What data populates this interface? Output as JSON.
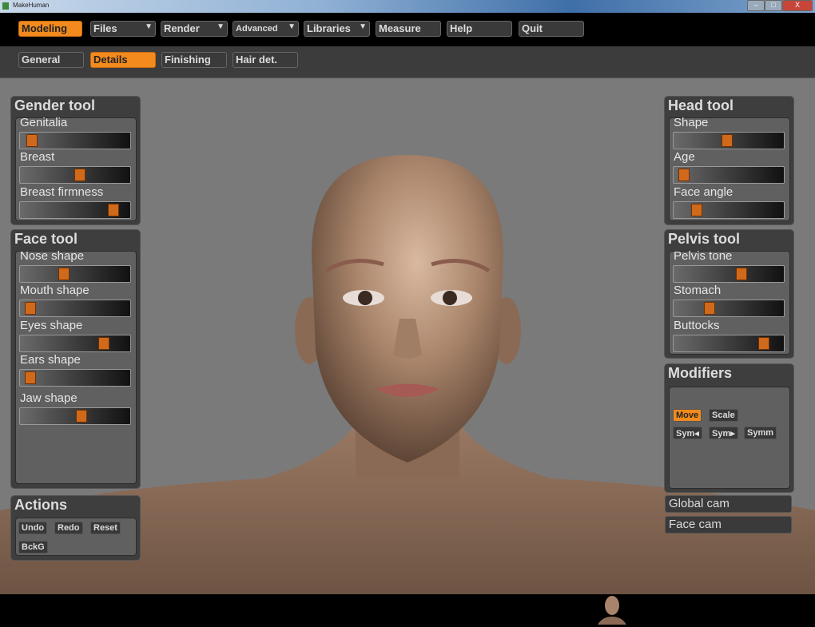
{
  "window": {
    "title": "MakeHuman",
    "minimize": "–",
    "maximize": "□",
    "close": "X"
  },
  "menu": [
    {
      "label": "Modeling",
      "active": true
    },
    {
      "label": "Files",
      "dropdown": true
    },
    {
      "label": "Render",
      "dropdown": true
    },
    {
      "label": "Advanced",
      "dropdown": true
    },
    {
      "label": "Libraries",
      "dropdown": true
    },
    {
      "label": "Measure"
    },
    {
      "label": "Help"
    },
    {
      "label": "Quit"
    }
  ],
  "arrow": "▼",
  "subtabs": [
    {
      "label": "General"
    },
    {
      "label": "Details",
      "active": true
    },
    {
      "label": "Finishing"
    },
    {
      "label": "Hair det."
    }
  ],
  "gender_tool": {
    "title": "Gender tool",
    "sliders": [
      {
        "label": "Genitalia",
        "value": 0.05
      },
      {
        "label": "Breast",
        "value": 0.55
      },
      {
        "label": "Breast firmness",
        "value": 0.9
      }
    ]
  },
  "face_tool": {
    "title": "Face tool",
    "sliders": [
      {
        "label": "Nose shape",
        "value": 0.38
      },
      {
        "label": "Mouth shape",
        "value": 0.03
      },
      {
        "label": "Eyes shape",
        "value": 0.8
      },
      {
        "label": "Ears shape",
        "value": 0.03
      },
      {
        "label": "Jaw shape",
        "value": 0.57
      }
    ]
  },
  "actions": {
    "title": "Actions",
    "buttons": [
      "Undo",
      "Redo",
      "Reset",
      "BckG"
    ]
  },
  "head_tool": {
    "title": "Head tool",
    "sliders": [
      {
        "label": "Shape",
        "value": 0.48
      },
      {
        "label": "Age",
        "value": 0.03
      },
      {
        "label": "Face angle",
        "value": 0.17
      }
    ]
  },
  "pelvis_tool": {
    "title": "Pelvis tool",
    "sliders": [
      {
        "label": "Pelvis tone",
        "value": 0.63
      },
      {
        "label": "Stomach",
        "value": 0.3
      },
      {
        "label": "Buttocks",
        "value": 0.87
      }
    ]
  },
  "modifiers": {
    "title": "Modifiers",
    "buttons": [
      {
        "label": "Move",
        "active": true
      },
      {
        "label": "Scale"
      },
      {
        "label": "Sym◂"
      },
      {
        "label": "Sym▸"
      },
      {
        "label": "Symm"
      }
    ]
  },
  "cameras": [
    "Global cam",
    "Face cam"
  ],
  "colors": {
    "accent": "#f28a1e",
    "panel": "#3e3e3e",
    "viewport": "#7a7a7a"
  }
}
